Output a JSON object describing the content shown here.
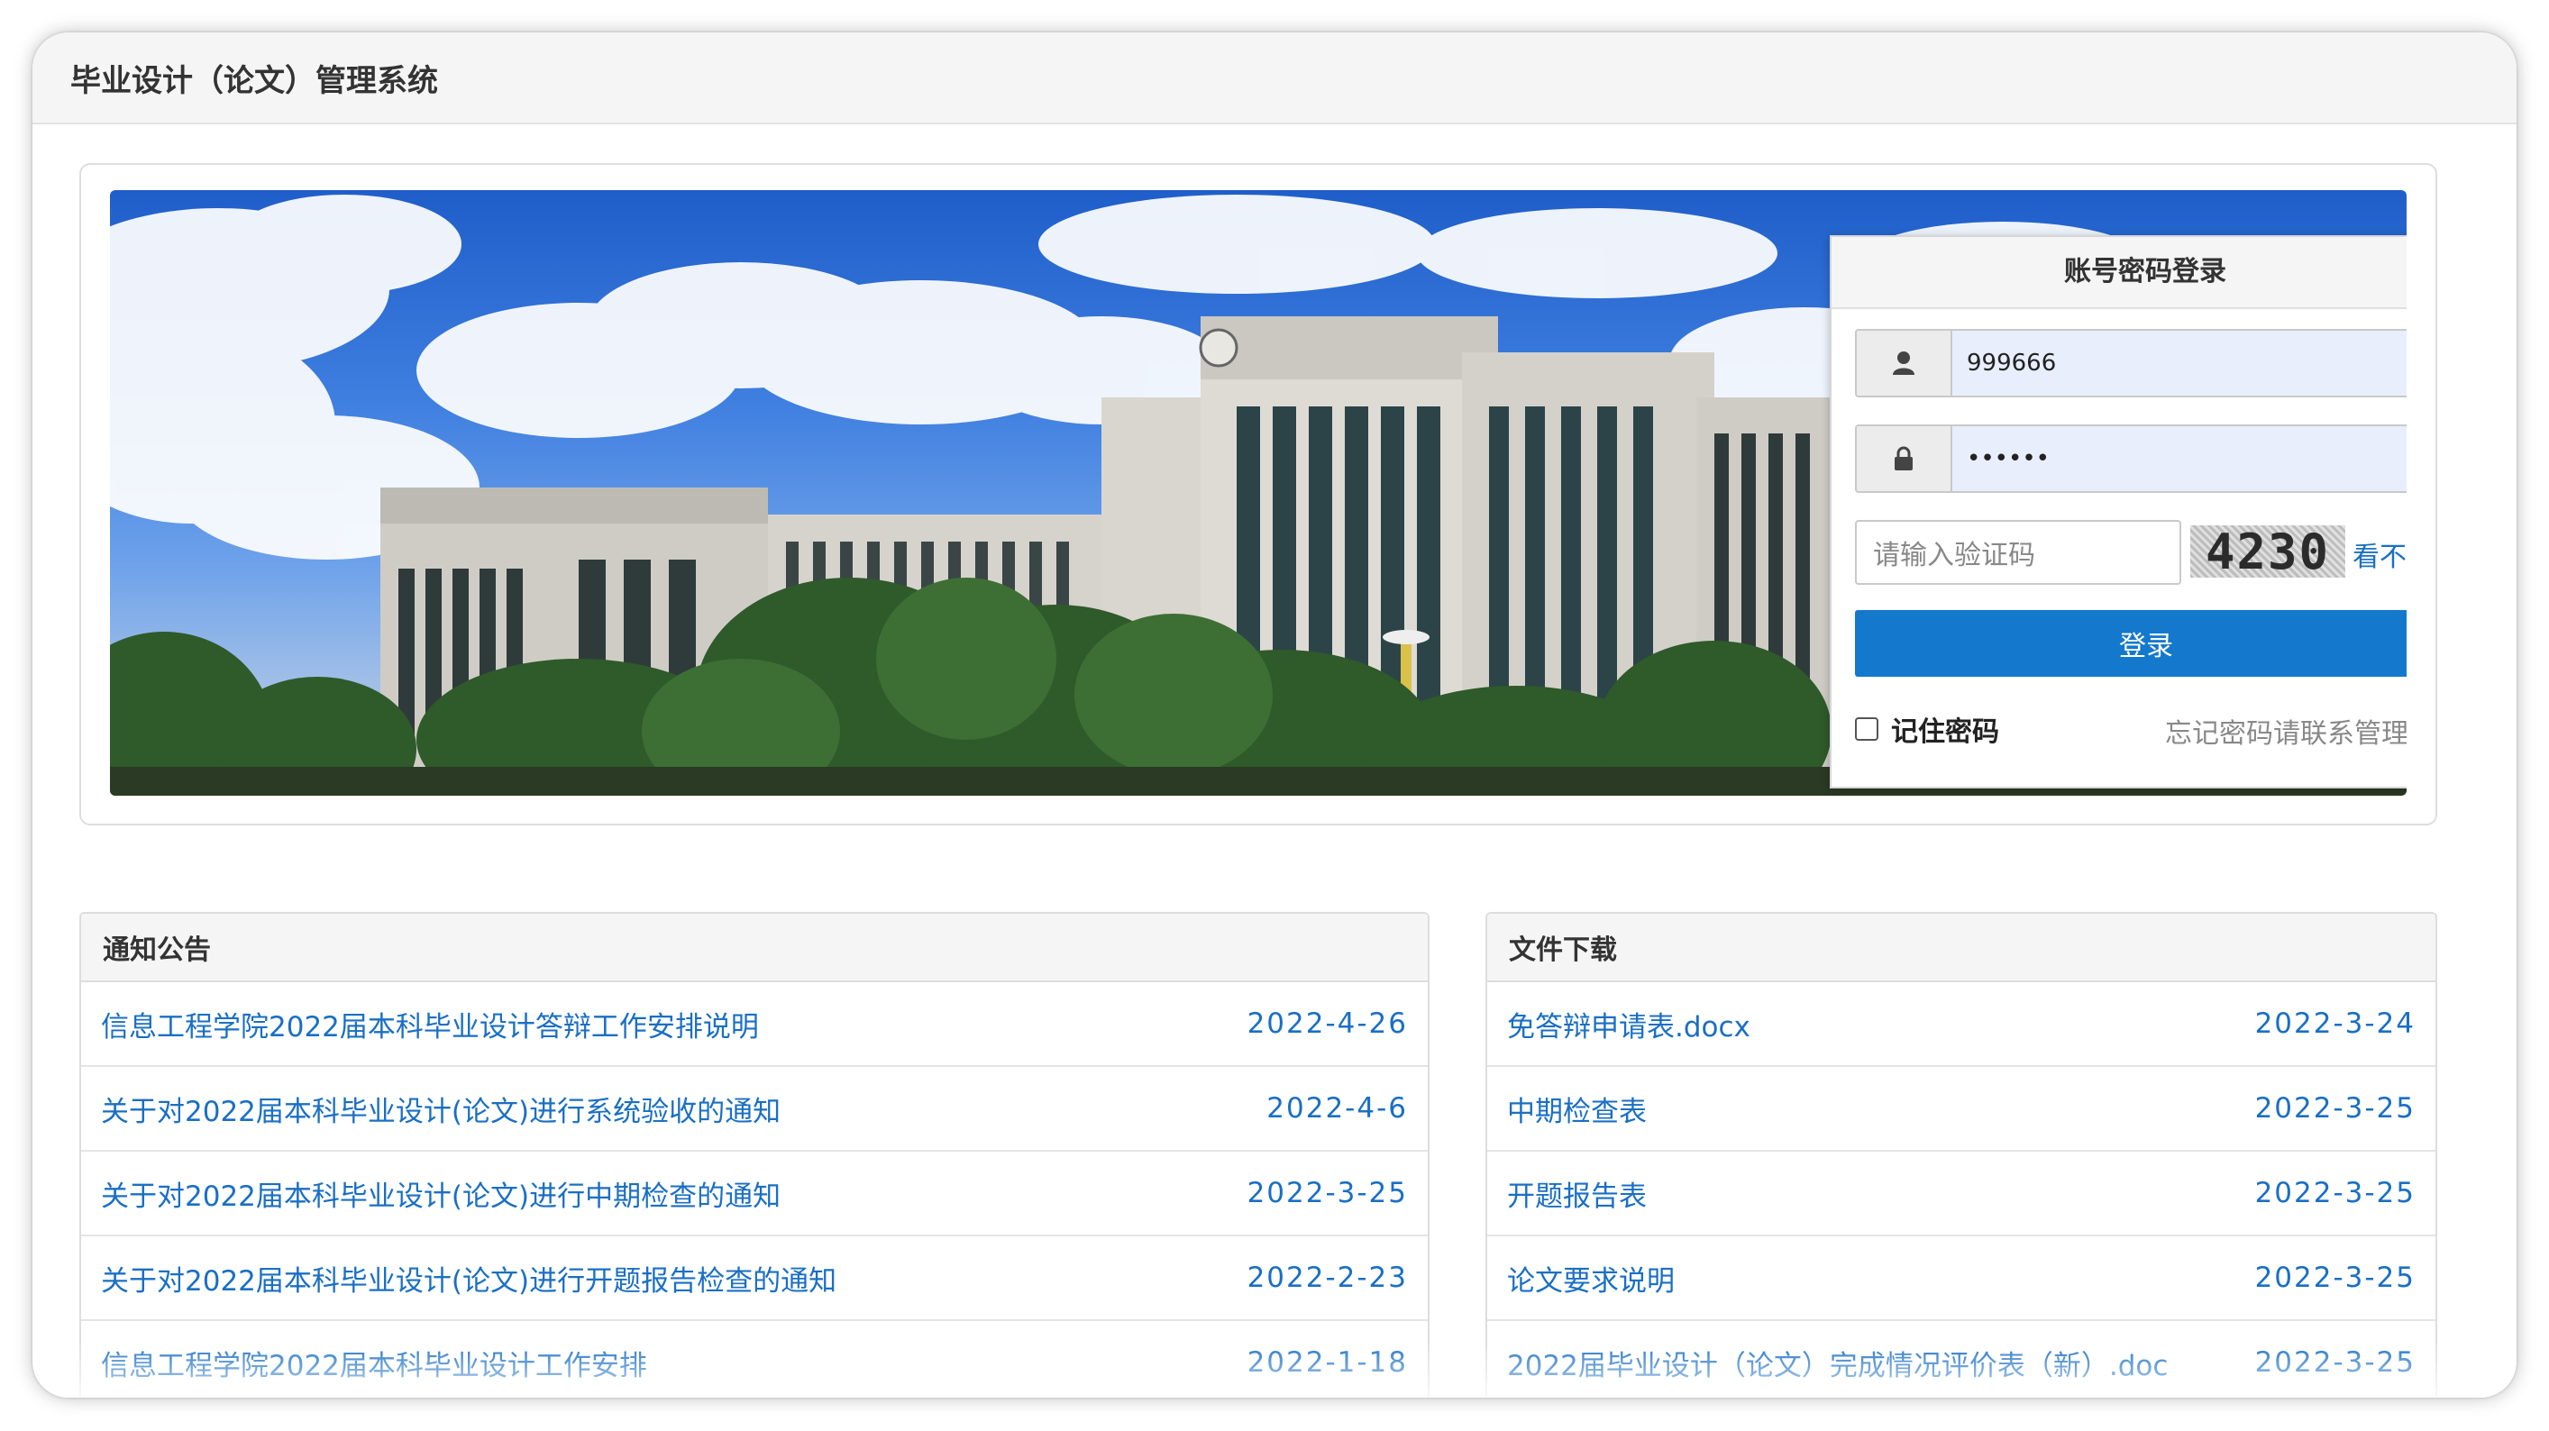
{
  "header": {
    "title": "毕业设计（论文）管理系统"
  },
  "login": {
    "heading": "账号密码登录",
    "username": "999666",
    "password_mask": "••••••",
    "captcha_placeholder": "请输入验证码",
    "captcha_code": "4230",
    "captcha_refresh": "看不清",
    "submit": "登录",
    "remember": "记住密码",
    "forgot": "忘记密码请联系管理员"
  },
  "notices": {
    "title": "通知公告",
    "items": [
      {
        "text": "信息工程学院2022届本科毕业设计答辩工作安排说明",
        "date": "2022-4-26"
      },
      {
        "text": "关于对2022届本科毕业设计(论文)进行系统验收的通知",
        "date": "2022-4-6"
      },
      {
        "text": "关于对2022届本科毕业设计(论文)进行中期检查的通知",
        "date": "2022-3-25"
      },
      {
        "text": "关于对2022届本科毕业设计(论文)进行开题报告检查的通知",
        "date": "2022-2-23"
      },
      {
        "text": "信息工程学院2022届本科毕业设计工作安排",
        "date": "2022-1-18"
      }
    ]
  },
  "files": {
    "title": "文件下载",
    "items": [
      {
        "text": "免答辩申请表.docx",
        "date": "2022-3-24"
      },
      {
        "text": "中期检查表",
        "date": "2022-3-25"
      },
      {
        "text": "开题报告表",
        "date": "2022-3-25"
      },
      {
        "text": "论文要求说明",
        "date": "2022-3-25"
      },
      {
        "text": "2022届毕业设计（论文）完成情况评价表（新）.doc",
        "date": "2022-3-25"
      }
    ]
  },
  "colors": {
    "link": "#1a6fc4",
    "button": "#1479cc"
  },
  "icons": {
    "user": "user-icon",
    "lock": "lock-icon"
  }
}
